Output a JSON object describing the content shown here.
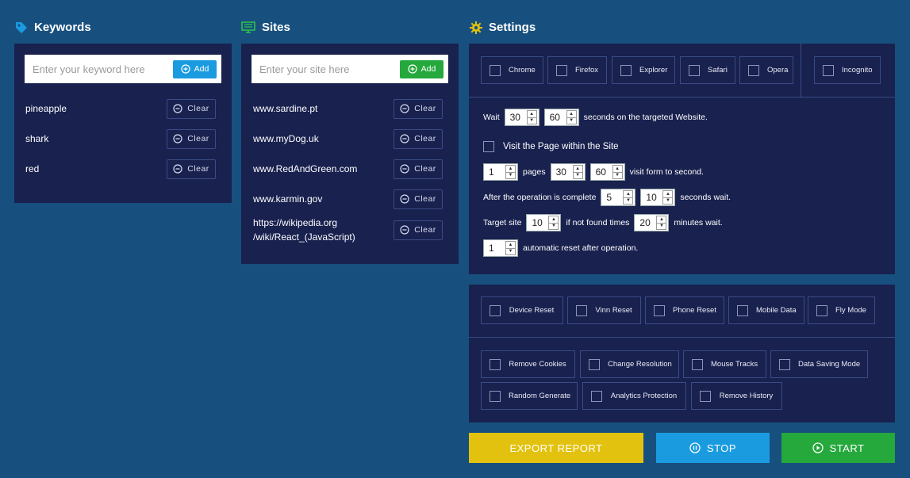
{
  "keywords": {
    "title": "Keywords",
    "placeholder": "Enter your keyword here",
    "add_label": "Add",
    "items": [
      {
        "label": "pineapple",
        "clear": "Clear"
      },
      {
        "label": "shark",
        "clear": "Clear"
      },
      {
        "label": "red",
        "clear": "Clear"
      }
    ]
  },
  "sites": {
    "title": "Sites",
    "placeholder": "Enter your site here",
    "add_label": "Add",
    "items": [
      {
        "label": "www.sardine.pt",
        "clear": "Clear"
      },
      {
        "label": "www.myDog.uk",
        "clear": "Clear"
      },
      {
        "label": "www.RedAndGreen.com",
        "clear": "Clear"
      },
      {
        "label": "www.karmin.gov",
        "clear": "Clear"
      },
      {
        "label_line1": "https://wikipedia.org",
        "label_line2": "/wiki/React_(JavaScript)",
        "clear": "Clear"
      }
    ]
  },
  "settings": {
    "title": "Settings",
    "browsers": [
      "Chrome",
      "Firefox",
      "Explorer",
      "Safari",
      "Opera"
    ],
    "incognito": "Incognito",
    "wait": {
      "label": "Wait",
      "min": "30",
      "max": "60",
      "suffix": "seconds on the targeted Website."
    },
    "visit_page": "Visit the Page within the Site",
    "pages": {
      "count": "1",
      "label": "pages",
      "from": "30",
      "to": "60",
      "suffix": "visit form to second."
    },
    "after_op": {
      "label": "After the operation is complete",
      "min": "5",
      "max": "10",
      "suffix": "seconds wait."
    },
    "target": {
      "label": "Target site",
      "times": "10",
      "mid": "if not found times",
      "minutes": "20",
      "suffix": "minutes wait."
    },
    "auto_reset": {
      "value": "1",
      "suffix": "automatic reset after operation."
    },
    "device_options": [
      "Device Reset",
      "Vinn Reset",
      "Phone Reset",
      "Mobile Data",
      "Fly Mode"
    ],
    "extra_row1": [
      "Remove Cookies",
      "Change Resolution",
      "Mouse Tracks",
      "Data Saving Mode"
    ],
    "extra_row2": [
      "Random Generate",
      "Analytics Protection",
      "Remove History"
    ]
  },
  "actions": {
    "export": "EXPORT REPORT",
    "stop": "STOP",
    "start": "START"
  },
  "colors": {
    "background": "#17507f",
    "panel": "#19214f",
    "export": "#e2c20e",
    "stop": "#1a9be0",
    "start": "#25a83c",
    "keyword_icon": "#1a9be0",
    "sites_icon": "#2fbf4a",
    "settings_icon": "#e2c20e"
  }
}
